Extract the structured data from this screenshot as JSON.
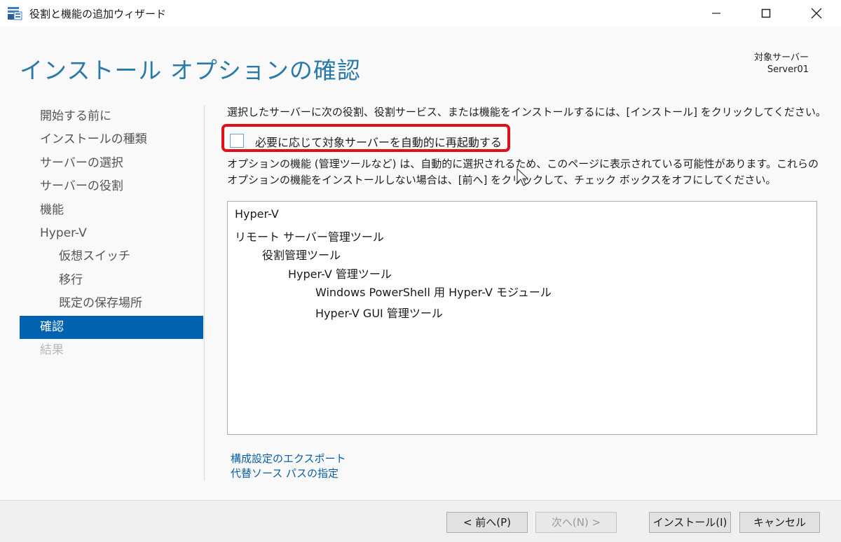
{
  "window": {
    "title": "役割と機能の追加ウィザード",
    "icon": "server-manager-icon"
  },
  "header": {
    "page_title": "インストール オプションの確認",
    "target_label": "対象サーバー",
    "target_value": "Server01"
  },
  "nav": {
    "items": [
      {
        "label": "開始する前に",
        "state": "normal"
      },
      {
        "label": "インストールの種類",
        "state": "normal"
      },
      {
        "label": "サーバーの選択",
        "state": "normal"
      },
      {
        "label": "サーバーの役割",
        "state": "normal"
      },
      {
        "label": "機能",
        "state": "normal"
      },
      {
        "label": "Hyper-V",
        "state": "normal"
      },
      {
        "label": "仮想スイッチ",
        "state": "sub"
      },
      {
        "label": "移行",
        "state": "sub"
      },
      {
        "label": "既定の保存場所",
        "state": "sub"
      },
      {
        "label": "確認",
        "state": "active"
      },
      {
        "label": "結果",
        "state": "disabled"
      }
    ]
  },
  "content": {
    "intro": "選択したサーバーに次の役割、役割サービス、または機能をインストールするには、[インストール] をクリックしてください。",
    "restart_label": "必要に応じて対象サーバーを自動的に再起動する",
    "restart_checked": false,
    "note": "オプションの機能 (管理ツールなど) は、自動的に選択されるため、このページに表示されている可能性があります。これらのオプションの機能をインストールしない場合は、[前へ] をクリックして、チェック ボックスをオフにしてください。",
    "features": [
      {
        "label": "Hyper-V",
        "level": 0
      },
      {
        "label": "リモート サーバー管理ツール",
        "level": 0
      },
      {
        "label": "役割管理ツール",
        "level": 1
      },
      {
        "label": "Hyper-V 管理ツール",
        "level": 2
      },
      {
        "label": "Windows PowerShell 用 Hyper-V モジュール",
        "level": 3
      },
      {
        "label": "Hyper-V GUI 管理ツール",
        "level": 3
      }
    ],
    "links": {
      "export": "構成設定のエクスポート",
      "alt_source": "代替ソース パスの指定"
    }
  },
  "footer": {
    "prev": "< 前へ(P)",
    "next": "次へ(N) >",
    "install": "インストール(I)",
    "cancel": "キャンセル"
  },
  "colors": {
    "accent": "#0063b1",
    "title": "#2a7aa8",
    "highlight": "#e0101a",
    "link": "#0a5ea8"
  }
}
